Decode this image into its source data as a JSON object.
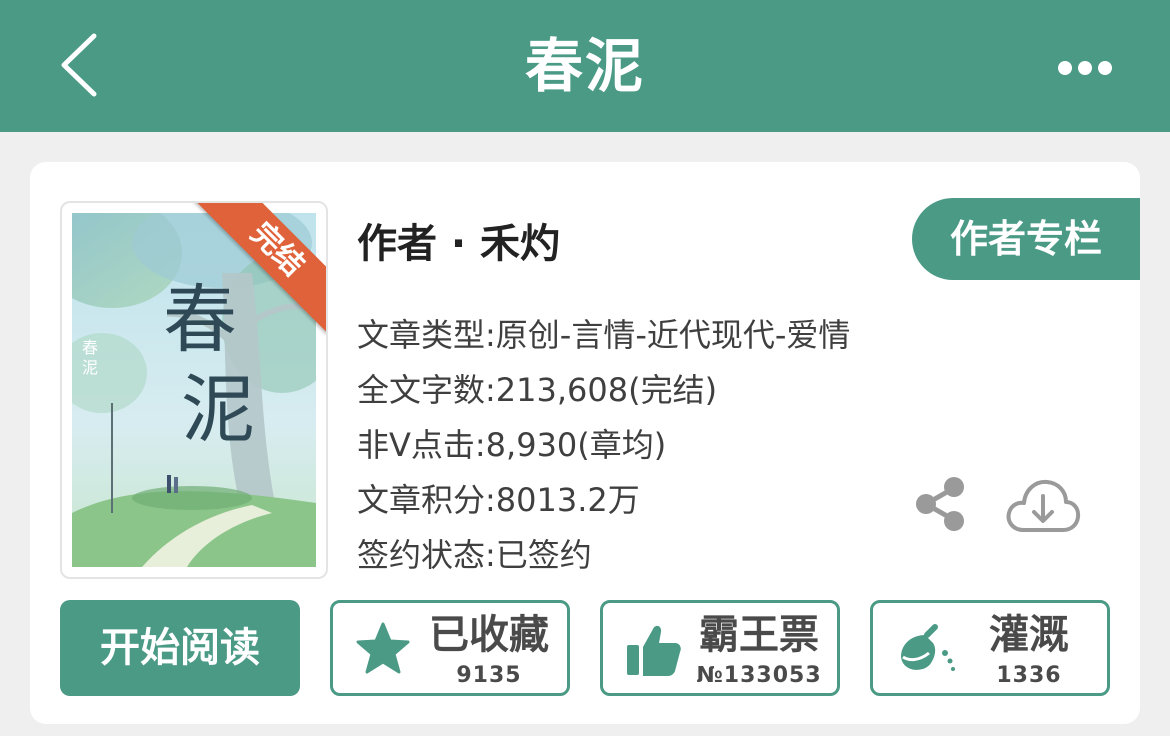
{
  "header": {
    "title": "春泥",
    "back_icon": "chevron-left-icon",
    "more_icon": "more-dots-icon"
  },
  "book": {
    "cover_title": "春泥",
    "ribbon": "完结",
    "author_line": "作者 · 禾灼",
    "author_column_button": "作者专栏",
    "info": [
      "文章类型:原创-言情-近代现代-爱情",
      "全文字数:213,608(完结)",
      "非V点击:8,930(章均)",
      "文章积分:8013.2万",
      "签约状态:已签约"
    ],
    "share_icon": "share-icon",
    "download_icon": "cloud-download-icon"
  },
  "actions": {
    "start_reading": "开始阅读",
    "buttons": [
      {
        "label": "已收藏",
        "count": "9135",
        "icon": "star-icon"
      },
      {
        "label": "霸王票",
        "count": "№133053",
        "icon": "thumbs-up-icon"
      },
      {
        "label": "灌溉",
        "count": "1336",
        "icon": "watering-flask-icon"
      }
    ]
  },
  "colors": {
    "brand": "#4a9a86",
    "ribbon": "#e0623a",
    "background": "#efefef"
  }
}
